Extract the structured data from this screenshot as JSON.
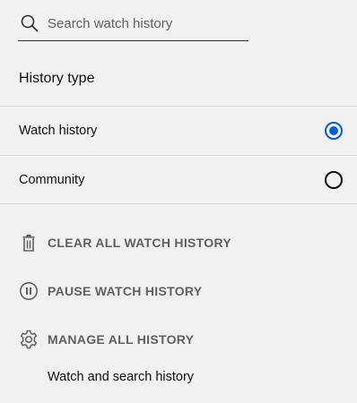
{
  "search": {
    "placeholder": "Search watch history",
    "value": ""
  },
  "history_type": {
    "title": "History type",
    "options": [
      {
        "label": "Watch history",
        "selected": true
      },
      {
        "label": "Community",
        "selected": false
      }
    ]
  },
  "actions": [
    {
      "label": "CLEAR ALL WATCH HISTORY",
      "icon": "trash-icon"
    },
    {
      "label": "PAUSE WATCH HISTORY",
      "icon": "pause-circle-icon"
    },
    {
      "label": "MANAGE ALL HISTORY",
      "icon": "gear-icon"
    }
  ],
  "manage_sub": {
    "link": "Watch and search history"
  },
  "colors": {
    "accent": "#065fd4",
    "action_text": "#606060",
    "background": "#f1f1f1"
  }
}
